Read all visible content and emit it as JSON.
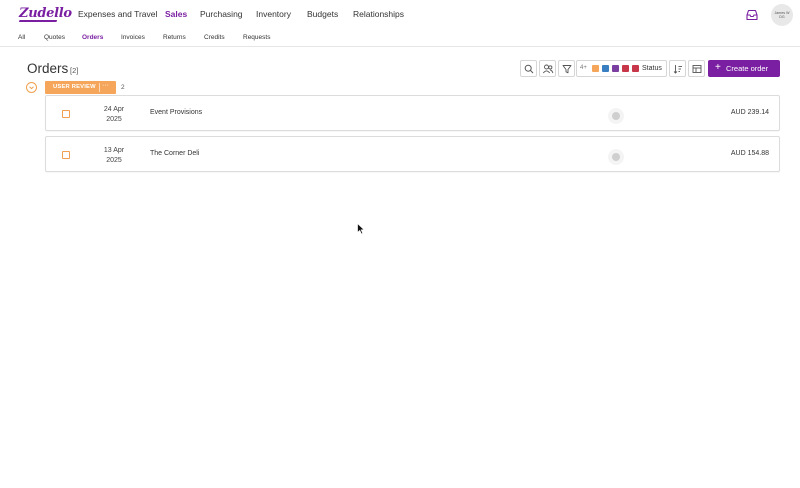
{
  "app": {
    "logo": "Zudello"
  },
  "nav": {
    "items": [
      {
        "label": "Expenses and Travel",
        "active": false
      },
      {
        "label": "Sales",
        "active": true
      },
      {
        "label": "Purchasing",
        "active": false
      },
      {
        "label": "Inventory",
        "active": false
      },
      {
        "label": "Budgets",
        "active": false
      },
      {
        "label": "Relationships",
        "active": false
      }
    ],
    "user_initials_line1": "James W",
    "user_initials_line2": "DG"
  },
  "subnav": {
    "items": [
      {
        "label": "All",
        "active": false
      },
      {
        "label": "Quotes",
        "active": false
      },
      {
        "label": "Orders",
        "active": true
      },
      {
        "label": "Invoices",
        "active": false
      },
      {
        "label": "Returns",
        "active": false
      },
      {
        "label": "Credits",
        "active": false
      },
      {
        "label": "Requests",
        "active": false
      }
    ]
  },
  "page": {
    "title": "Orders",
    "count": "[2]"
  },
  "toolbar": {
    "status_count": "4+",
    "status_label": "Status",
    "status_colors": [
      "#f5a65b",
      "#3a7fc1",
      "#7a3fa0",
      "#c8364a",
      "#c8364a"
    ],
    "create_label": "Create order",
    "accent": "#7a1fa2"
  },
  "group": {
    "label": "USER REVIEW",
    "more": "···",
    "count": "2",
    "color": "#f5a65b"
  },
  "orders": [
    {
      "date_day": "24 Apr",
      "date_year": "2025",
      "name": "Event Provisions",
      "amount": "AUD 239.14"
    },
    {
      "date_day": "13 Apr",
      "date_year": "2025",
      "name": "The Corner Deli",
      "amount": "AUD 154.88"
    }
  ]
}
